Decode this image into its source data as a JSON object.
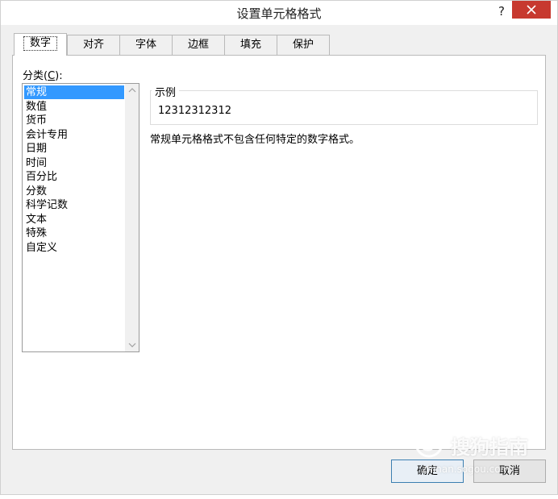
{
  "window": {
    "title": "设置单元格格式",
    "help_label": "?"
  },
  "tabs": [
    {
      "label": "数字",
      "active": true
    },
    {
      "label": "对齐"
    },
    {
      "label": "字体"
    },
    {
      "label": "边框"
    },
    {
      "label": "填充"
    },
    {
      "label": "保护"
    }
  ],
  "category": {
    "label_prefix": "分类(",
    "label_key": "C",
    "label_suffix": "):",
    "items": [
      "常规",
      "数值",
      "货币",
      "会计专用",
      "日期",
      "时间",
      "百分比",
      "分数",
      "科学记数",
      "文本",
      "特殊",
      "自定义"
    ],
    "selected": "常规"
  },
  "sample": {
    "legend": "示例",
    "value": "12312312312"
  },
  "description": "常规单元格格式不包含任何特定的数字格式。",
  "buttons": {
    "ok": "确定",
    "cancel": "取消"
  },
  "watermark": {
    "text": "搜狗指南",
    "url": "zhinan.sogou.com"
  },
  "colors": {
    "selection": "#3399ff",
    "close_button": "#c7392f",
    "default_button_border": "#3c7fb1"
  },
  "icons": {
    "close": "close-icon",
    "scroll_up": "chevron-up-icon",
    "scroll_down": "chevron-down-icon",
    "watermark": "sogou-logo-icon"
  }
}
